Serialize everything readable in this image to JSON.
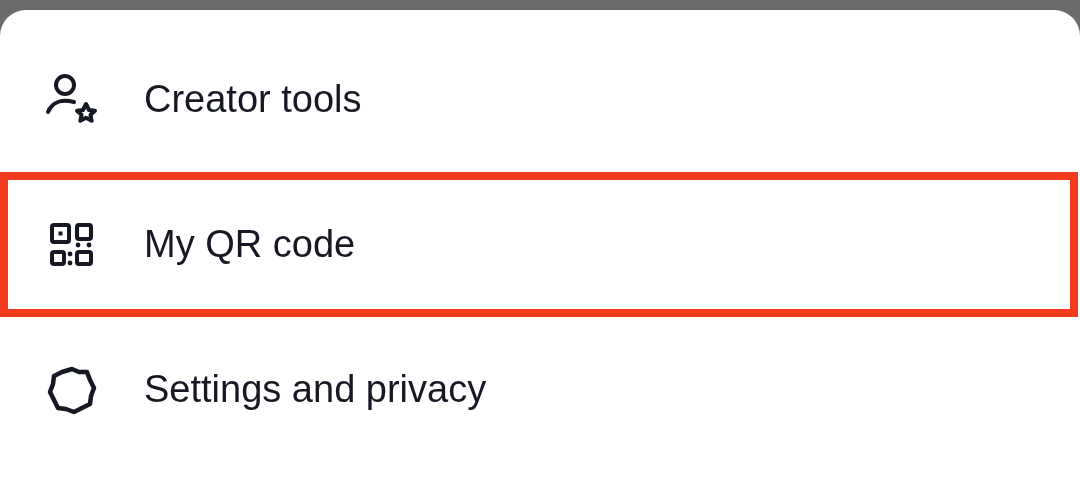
{
  "menu": {
    "items": [
      {
        "kind": "creator",
        "label": "Creator tools",
        "highlighted": false
      },
      {
        "kind": "qr",
        "label": "My QR code",
        "highlighted": true
      },
      {
        "kind": "settings",
        "label": "Settings and privacy",
        "highlighted": false
      }
    ]
  }
}
